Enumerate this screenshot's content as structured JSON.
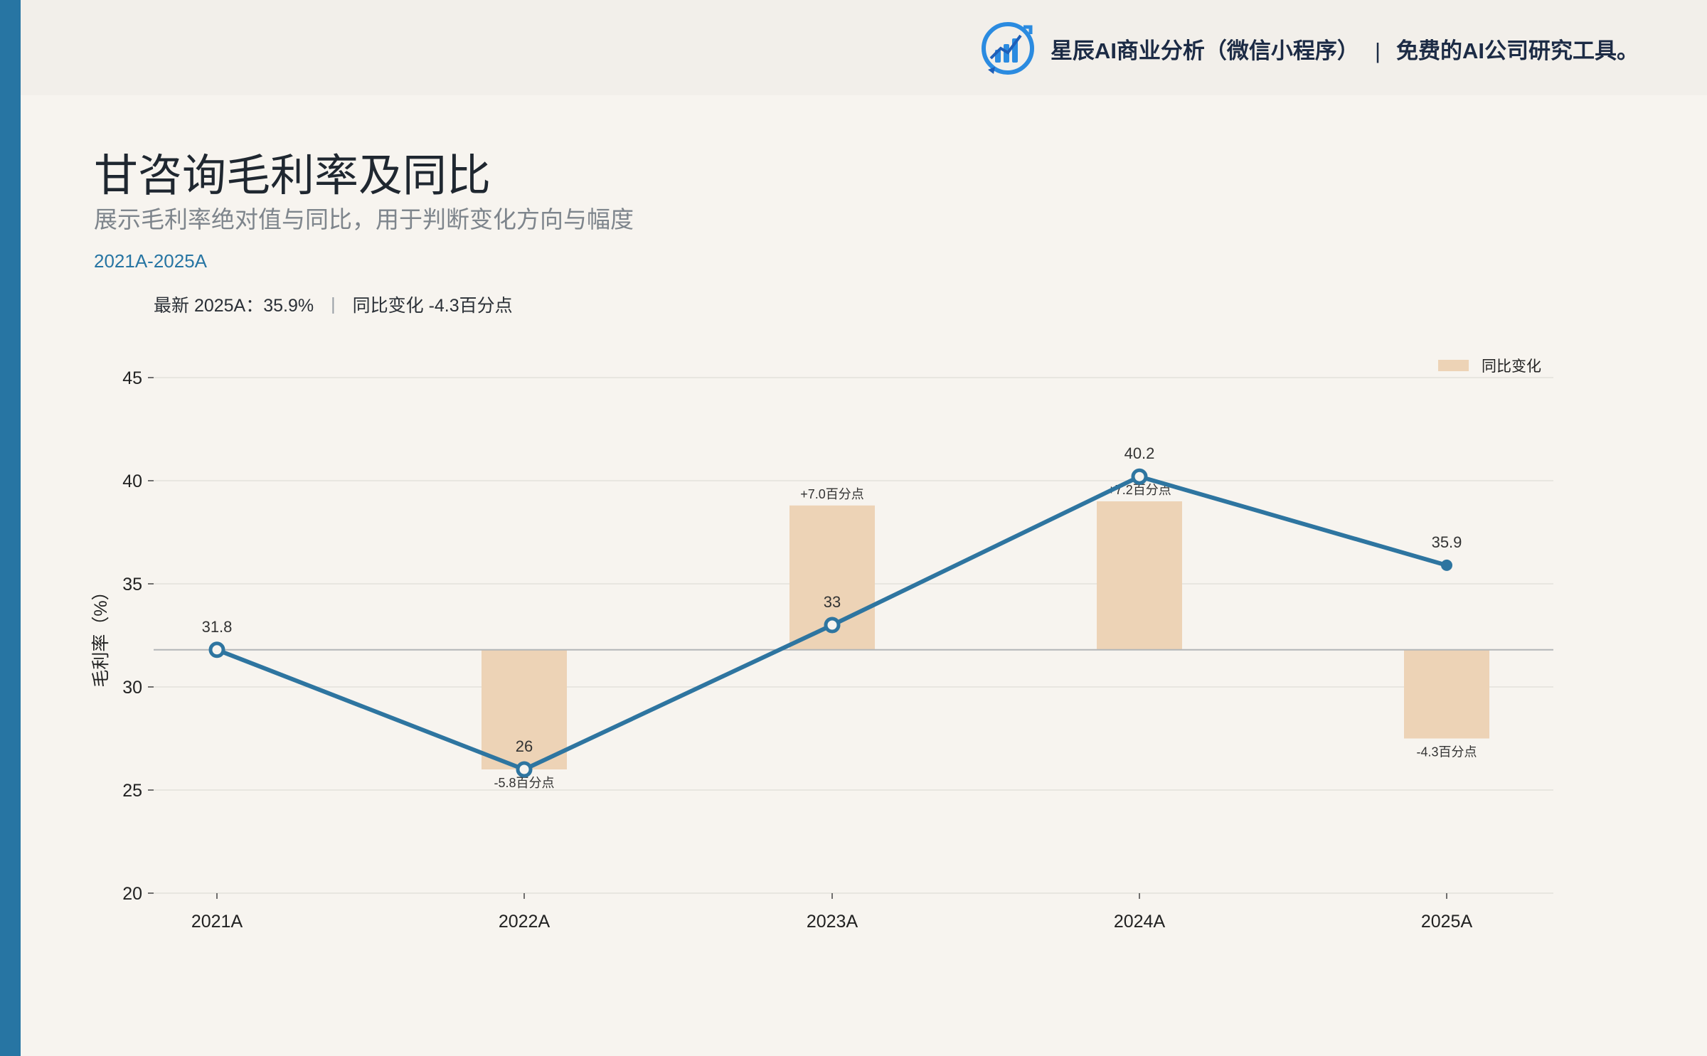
{
  "brand": {
    "logo_icon": "bar-chart-logo-icon",
    "name": "星辰AI商业分析（微信小程序）",
    "separator": "|",
    "tagline": "免费的AI公司研究工具。"
  },
  "title": "甘咨询毛利率及同比",
  "subtitle": "展示毛利率绝对值与同比，用于判断变化方向与幅度",
  "period": "2021A-2025A",
  "summary": {
    "latest": "最新 2025A：35.9%",
    "separator": "|",
    "change": "同比变化 -4.3百分点"
  },
  "colors": {
    "accent": "#2775a3",
    "line": "#2e75a0",
    "bar": "#edd3b6",
    "grid": "#e4e1dc",
    "baseline": "#b3b6b8"
  },
  "chart_data": {
    "type": "line",
    "categories": [
      "2021A",
      "2022A",
      "2023A",
      "2024A",
      "2025A"
    ],
    "series": [
      {
        "name": "",
        "values": [
          31.8,
          26,
          33,
          40.2,
          35.9
        ]
      }
    ],
    "value_labels": [
      "31.8",
      "26",
      "33",
      "40.2",
      "35.9"
    ],
    "yoy": {
      "name": "同比变化",
      "values": [
        null,
        -5.8,
        7.0,
        7.2,
        -4.3
      ],
      "labels": [
        "",
        "-5.8百分点",
        "+7.0百分点",
        "+7.2百分点",
        "-4.3百分点"
      ]
    },
    "ylabel": "毛利率（%）",
    "yticks": [
      20,
      25,
      30,
      35,
      40,
      45
    ],
    "ylim": [
      20,
      46.5
    ],
    "baseline": 31.8,
    "grid": true,
    "legend_position": "top-right"
  }
}
